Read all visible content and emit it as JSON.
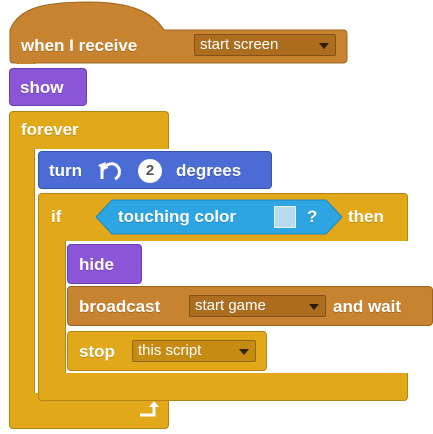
{
  "colors": {
    "events": "#c88330",
    "events_dropdown": "#ad6d1f",
    "looks": "#8a55d7",
    "control": "#e1a91a",
    "control_dropdown": "#c58b12",
    "motion": "#4a6cd4",
    "sensing": "#2ca5e2",
    "swatch": "#b7dcf0"
  },
  "hat": {
    "label": "when I receive",
    "dropdown": "start screen"
  },
  "show_block": {
    "label": "show"
  },
  "forever_block": {
    "label": "forever",
    "loop_icon": "loop-arrow-icon"
  },
  "turn_block": {
    "label_turn": "turn",
    "icon": "rotate-left-icon",
    "value": "2",
    "label_degrees": "degrees"
  },
  "if_block": {
    "label_if": "if",
    "condition_label": "touching color",
    "condition_mark": "?",
    "label_then": "then"
  },
  "hide_block": {
    "label": "hide"
  },
  "broadcast_block": {
    "label": "broadcast",
    "dropdown": "start game",
    "suffix": "and wait"
  },
  "stop_block": {
    "label": "stop",
    "dropdown": "this script"
  }
}
